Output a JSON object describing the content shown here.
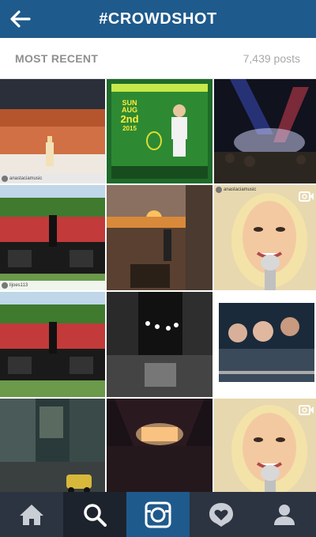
{
  "header": {
    "title": "#CROWDSHOT",
    "back_icon": "arrow-left-icon"
  },
  "section": {
    "label": "MOST RECENT",
    "post_count": "7,439 posts"
  },
  "grid": {
    "tiles": [
      {
        "name": "concert-crowd-stage-photo",
        "credit": "anastaciamusic"
      },
      {
        "name": "tennis-event-flyer-photo"
      },
      {
        "name": "concert-lights-crowd-photo"
      },
      {
        "name": "outdoor-stage-singer-photo",
        "credit": "lijoes113"
      },
      {
        "name": "sunset-stage-crowd-photo"
      },
      {
        "name": "singer-closeup-video",
        "credit": "anastaciamusic",
        "video": true
      },
      {
        "name": "outdoor-stage-singer-photo-2"
      },
      {
        "name": "night-street-crowd-photo"
      },
      {
        "name": "fans-at-barrier-photo"
      },
      {
        "name": "vintage-city-street-photo"
      },
      {
        "name": "dark-concert-stage-photo"
      },
      {
        "name": "singer-closeup-video-2",
        "video": true
      }
    ],
    "flyer_text": {
      "day": "SUN",
      "month": "AUG",
      "date": "2nd",
      "year": "2015"
    }
  },
  "bottom_nav": {
    "items": [
      {
        "icon": "home-icon"
      },
      {
        "icon": "search-icon"
      },
      {
        "icon": "camera-icon"
      },
      {
        "icon": "activity-icon"
      },
      {
        "icon": "profile-icon"
      }
    ]
  },
  "colors": {
    "header_bg": "#1f5a8c",
    "nav_bg": "#2b3440",
    "camera_bg": "#1f5a8c"
  }
}
